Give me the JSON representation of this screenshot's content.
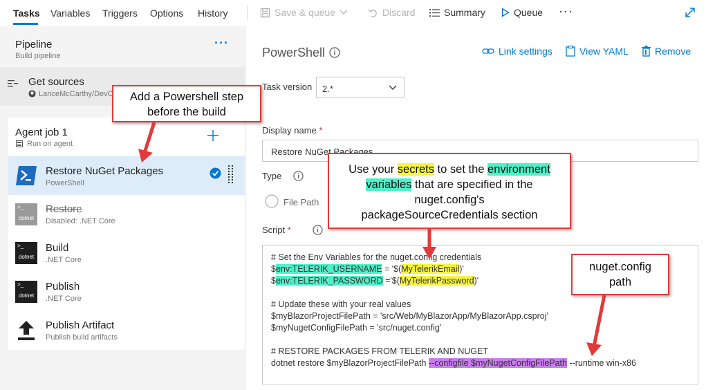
{
  "tabs": [
    "Tasks",
    "Variables",
    "Triggers",
    "Options",
    "History"
  ],
  "toolbar": {
    "save_queue": "Save & queue",
    "discard": "Discard",
    "summary": "Summary",
    "queue": "Queue",
    "more": "···"
  },
  "pipeline": {
    "title": "Pipeline",
    "subtitle": "Build pipeline",
    "more": "···"
  },
  "get_sources": {
    "title": "Get sources",
    "subtitle": "LanceMcCarthy/DevO"
  },
  "agent_job": {
    "title": "Agent job 1",
    "subtitle": "Run on agent"
  },
  "tasks": [
    {
      "title": "Restore NuGet Packages",
      "subtitle": "PowerShell"
    },
    {
      "title": "Restore",
      "subtitle": "Disabled: .NET Core"
    },
    {
      "title": "Build",
      "subtitle": ".NET Core"
    },
    {
      "title": "Publish",
      "subtitle": ".NET Core"
    },
    {
      "title": "Publish Artifact",
      "subtitle": "Publish build artifacts"
    }
  ],
  "dotnet_label": "dotnet",
  "right": {
    "title": "PowerShell",
    "link_settings": "Link settings",
    "view_yaml": "View YAML",
    "remove": "Remove",
    "task_version_label": "Task version",
    "task_version_value": "2.*",
    "display_name_label": "Display name",
    "display_name_value": "Restore NuGet Packages",
    "type_label": "Type",
    "file_path": "File Path",
    "script_label": "Script",
    "required_mark": "*"
  },
  "script": {
    "l1": "# Set the Env Variables for the nuget.config credentials",
    "l2a": "$",
    "l2b": "env:TELERIK_USERNAME",
    "l2c": " = '$(",
    "l2d": "MyTelerikEmail",
    "l2e": ")'",
    "l3a": "$",
    "l3b": "env:TELERIK_PASSWORD",
    "l3c": " ='$(",
    "l3d": "MyTelerikPassword",
    "l3e": ")'",
    "l4": "# Update these with your real values",
    "l5": "$myBlazorProjectFilePath = 'src/Web/MyBlazorApp/MyBlazorApp.csproj'",
    "l6": "$myNugetConfigFilePath = 'src/nuget.config'",
    "l7": "# RESTORE PACKAGES FROM TELERIK AND NUGET",
    "l8a": "dotnet restore $myBlazorProjectFilePath ",
    "l8b": "--configfile $myNugetConfigFilePath",
    "l8c": " --runtime win-x86"
  },
  "callouts": {
    "c1_line1": "Add a Powershell step",
    "c1_line2": "before the build",
    "c2_a": "Use your ",
    "c2_secrets": "secrets",
    "c2_b": " to set the ",
    "c2_env": "environment",
    "c2_vars": "variables",
    "c2_c": " that are specified in the",
    "c2_d": "nuget.config's",
    "c2_e": "packageSourceCredentials section",
    "c3_line1": "nuget.config",
    "c3_line2": "path"
  },
  "colors": {
    "accent": "#0078d4",
    "callout_border": "#e23a3a",
    "highlight_cyan": "#4ef0c8",
    "highlight_yellow": "#f5f542",
    "highlight_purple": "#c87dee"
  }
}
